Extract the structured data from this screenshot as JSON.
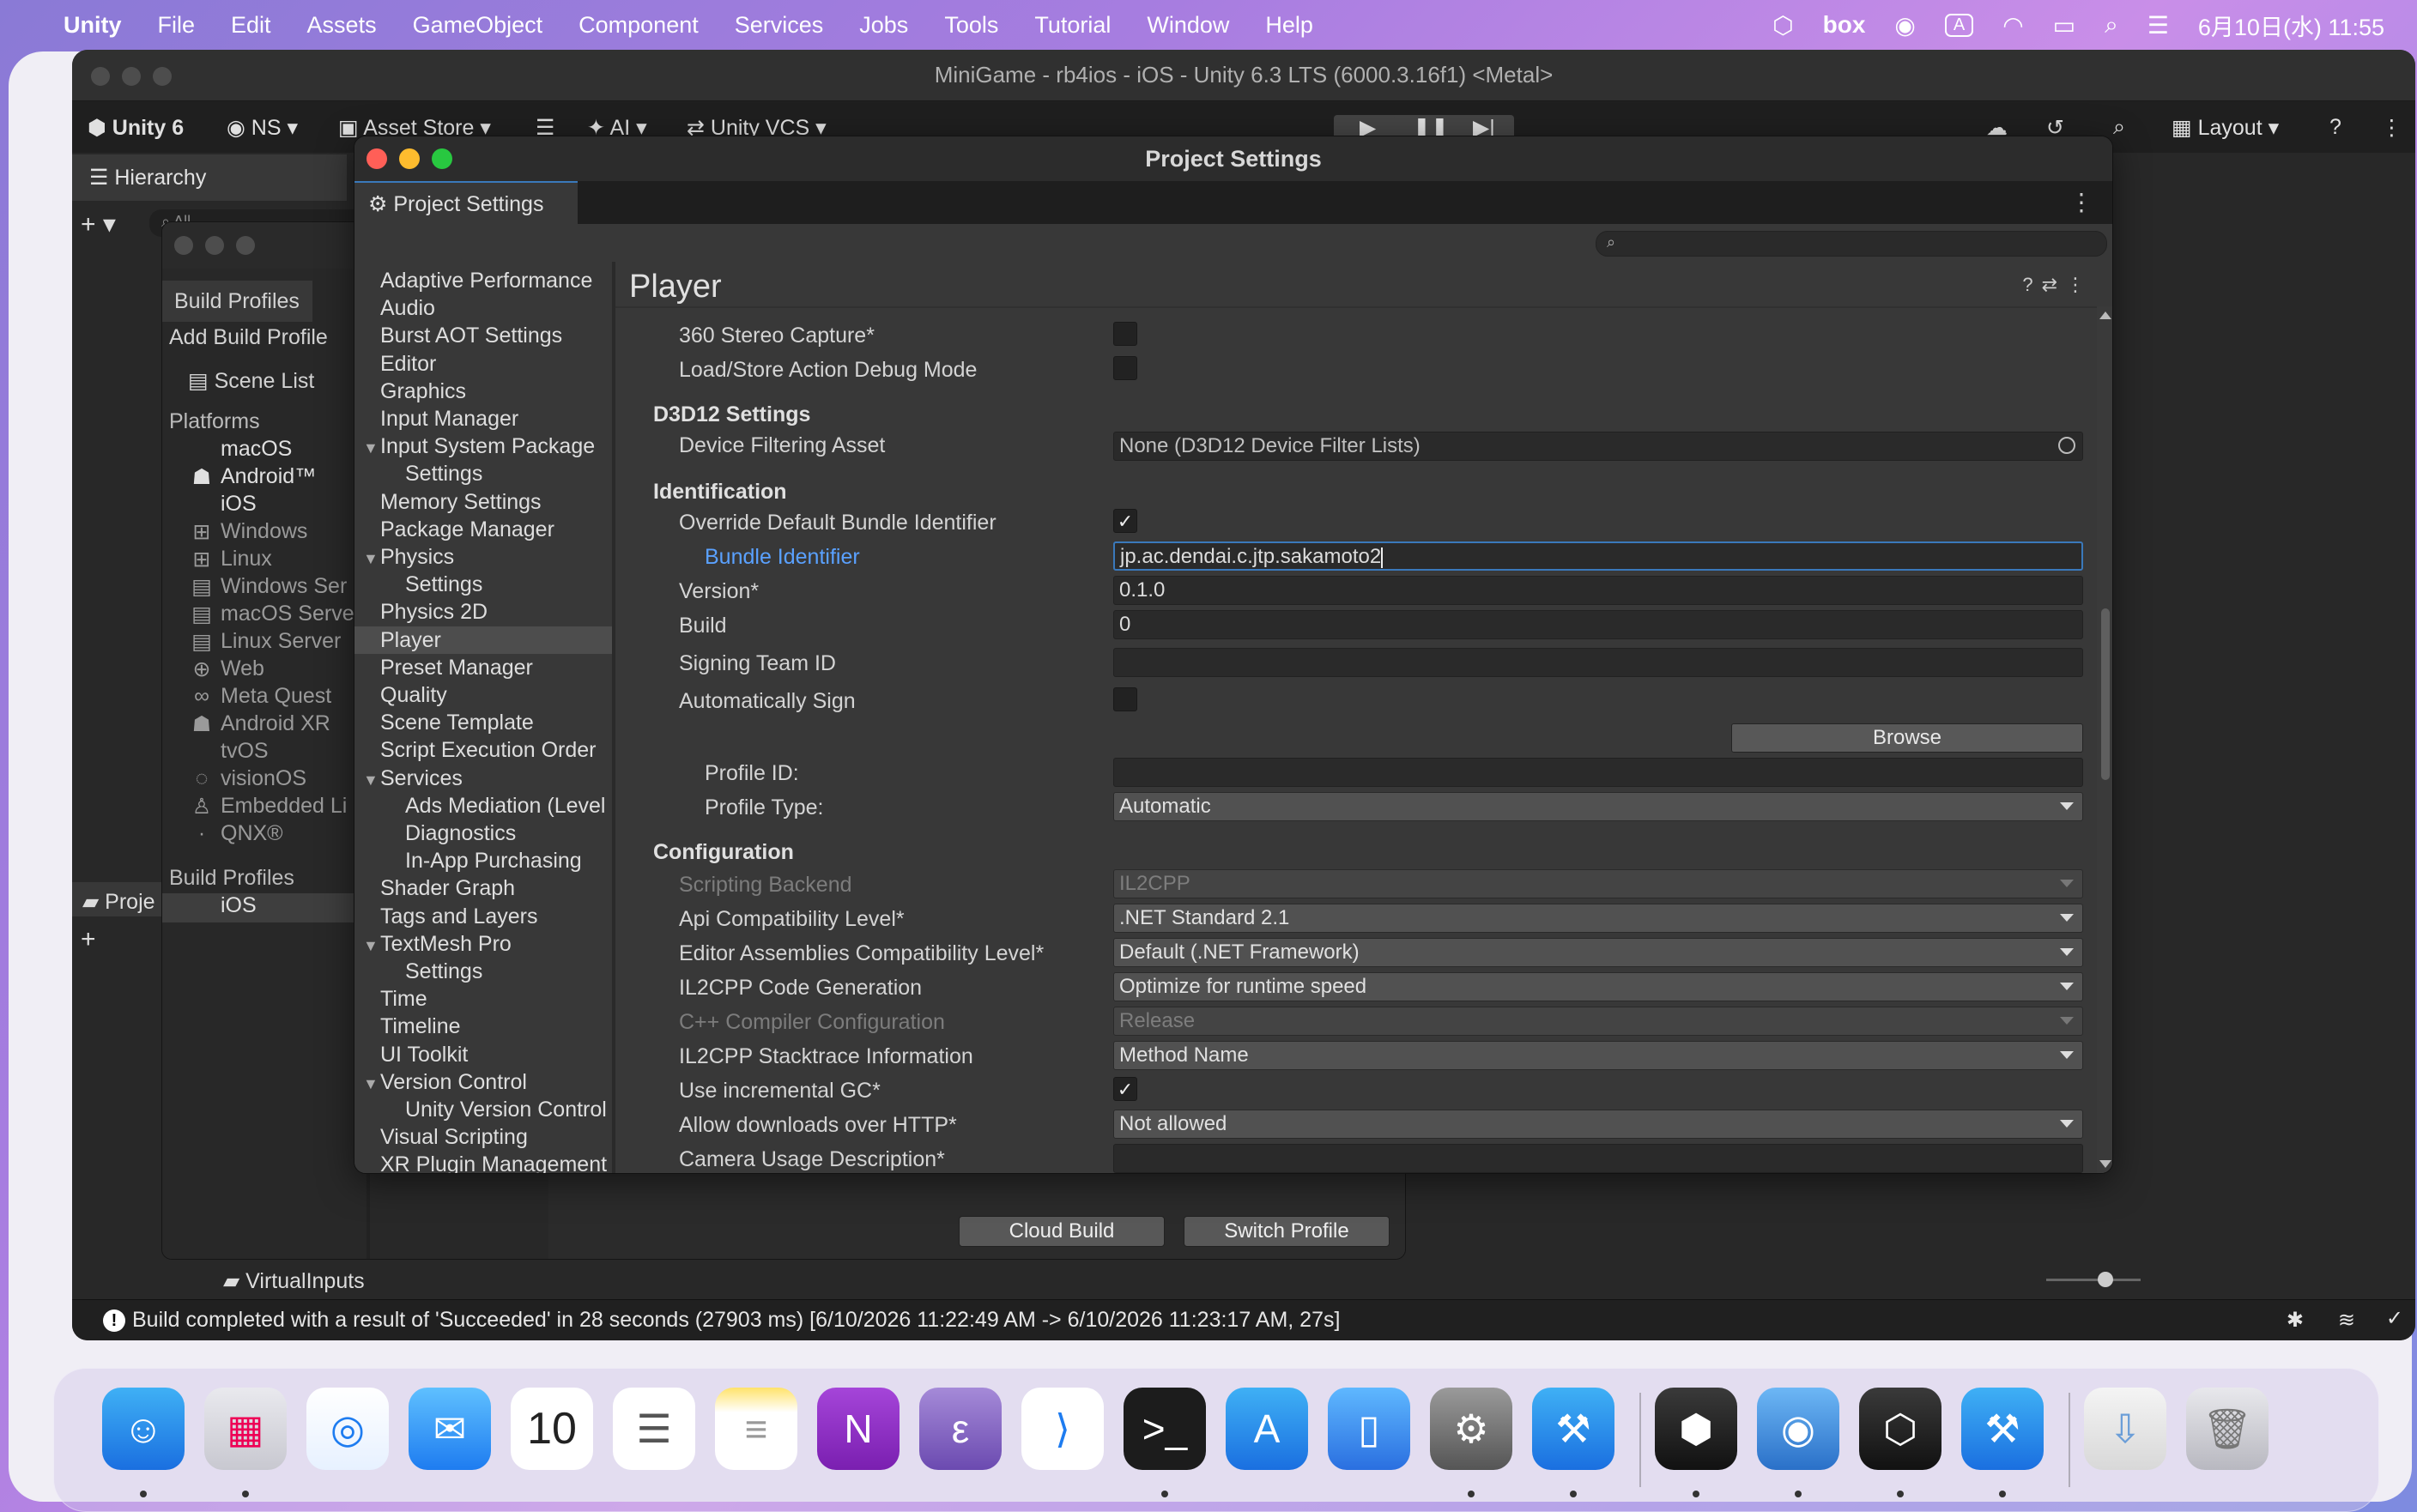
{
  "menubar": {
    "app": "Unity",
    "items": [
      "File",
      "Edit",
      "Assets",
      "GameObject",
      "Component",
      "Services",
      "Jobs",
      "Tools",
      "Tutorial",
      "Window",
      "Help"
    ],
    "box_label": "box",
    "input_badge": "A",
    "clock": "6月10日(水) 11:55"
  },
  "unity": {
    "window_title": "MiniGame - rb4ios - iOS - Unity 6.3 LTS (6000.3.16f1) <Metal>",
    "toolbar": {
      "unity_label": "Unity 6",
      "account": "NS",
      "asset_store": "Asset Store",
      "ai": "AI",
      "vcs": "Unity VCS",
      "layout": "Layout"
    },
    "hierarchy_tab": "Hierarchy",
    "search_placeholder": "All",
    "project_tab": "Proje",
    "virtual_inputs": "VirtualInputs",
    "status_message": "Build completed with a result of 'Succeeded' in 28 seconds (27903 ms) [6/10/2026 11:22:49 AM -> 6/10/2026 11:23:17 AM, 27s]"
  },
  "build_profiles": {
    "tab": "Build Profiles",
    "add": "Add Build Profile",
    "scene_list": "Scene List",
    "platforms_header": "Platforms",
    "platforms": [
      "macOS",
      "Android™",
      "iOS",
      "Windows",
      "Linux",
      "Windows Ser",
      "macOS Serve",
      "Linux Server",
      "Web",
      "Meta Quest",
      "Android XR",
      "tvOS",
      "visionOS",
      "Embedded Li",
      "QNX®"
    ],
    "profiles_header": "Build Profiles",
    "profiles": [
      "iOS"
    ],
    "cloud_build": "Cloud Build",
    "switch_profile": "Switch Profile"
  },
  "project_settings": {
    "window_title": "Project Settings",
    "tab_label": "Project Settings",
    "nav": [
      {
        "label": "Adaptive Performance",
        "level": 0
      },
      {
        "label": "Audio",
        "level": 0
      },
      {
        "label": "Burst AOT Settings",
        "level": 0
      },
      {
        "label": "Editor",
        "level": 0
      },
      {
        "label": "Graphics",
        "level": 0
      },
      {
        "label": "Input Manager",
        "level": 0
      },
      {
        "label": "Input System Package",
        "level": 0,
        "expanded": true
      },
      {
        "label": "Settings",
        "level": 1
      },
      {
        "label": "Memory Settings",
        "level": 0
      },
      {
        "label": "Package Manager",
        "level": 0
      },
      {
        "label": "Physics",
        "level": 0,
        "expanded": true
      },
      {
        "label": "Settings",
        "level": 1
      },
      {
        "label": "Physics 2D",
        "level": 0
      },
      {
        "label": "Player",
        "level": 0,
        "selected": true
      },
      {
        "label": "Preset Manager",
        "level": 0
      },
      {
        "label": "Quality",
        "level": 0
      },
      {
        "label": "Scene Template",
        "level": 0
      },
      {
        "label": "Script Execution Order",
        "level": 0
      },
      {
        "label": "Services",
        "level": 0,
        "expanded": true
      },
      {
        "label": "Ads Mediation (Level",
        "level": 1
      },
      {
        "label": "Diagnostics",
        "level": 1
      },
      {
        "label": "In-App Purchasing",
        "level": 1
      },
      {
        "label": "Shader Graph",
        "level": 0
      },
      {
        "label": "Tags and Layers",
        "level": 0
      },
      {
        "label": "TextMesh Pro",
        "level": 0,
        "expanded": true
      },
      {
        "label": "Settings",
        "level": 1
      },
      {
        "label": "Time",
        "level": 0
      },
      {
        "label": "Timeline",
        "level": 0
      },
      {
        "label": "UI Toolkit",
        "level": 0
      },
      {
        "label": "Version Control",
        "level": 0,
        "expanded": true
      },
      {
        "label": "Unity Version Control",
        "level": 1
      },
      {
        "label": "Visual Scripting",
        "level": 0
      },
      {
        "label": "XR Plugin Management",
        "level": 0
      }
    ],
    "player": {
      "header": "Player",
      "stereo_capture_label": "360 Stereo Capture*",
      "stereo_capture": false,
      "load_store_label": "Load/Store Action Debug Mode",
      "load_store": false,
      "d3d12_header": "D3D12 Settings",
      "device_filter_label": "Device Filtering Asset",
      "device_filter_value": "None (D3D12 Device Filter Lists)",
      "identification_header": "Identification",
      "override_bundle_label": "Override Default Bundle Identifier",
      "override_bundle": true,
      "bundle_id_label": "Bundle Identifier",
      "bundle_id_value": "jp.ac.dendai.c.jtp.sakamoto2",
      "version_label": "Version*",
      "version_value": "0.1.0",
      "build_label": "Build",
      "build_value": "0",
      "signing_team_label": "Signing Team ID",
      "signing_team_value": "",
      "auto_sign_label": "Automatically Sign",
      "auto_sign": false,
      "browse_label": "Browse",
      "profile_id_label": "Profile ID:",
      "profile_id_value": "",
      "profile_type_label": "Profile Type:",
      "profile_type_value": "Automatic",
      "configuration_header": "Configuration",
      "scripting_backend_label": "Scripting Backend",
      "scripting_backend_value": "IL2CPP",
      "api_compat_label": "Api Compatibility Level*",
      "api_compat_value": ".NET Standard 2.1",
      "editor_assemblies_label": "Editor Assemblies Compatibility Level*",
      "editor_assemblies_value": "Default (.NET Framework)",
      "il2cpp_codegen_label": "IL2CPP Code Generation",
      "il2cpp_codegen_value": "Optimize for runtime speed",
      "cpp_compiler_label": "C++ Compiler Configuration",
      "cpp_compiler_value": "Release",
      "stacktrace_label": "IL2CPP Stacktrace Information",
      "stacktrace_value": "Method Name",
      "incremental_gc_label": "Use incremental GC*",
      "incremental_gc": true,
      "http_label": "Allow downloads over HTTP*",
      "http_value": "Not allowed",
      "camera_usage_label": "Camera Usage Description*",
      "camera_usage_value": ""
    }
  },
  "dock": {
    "calendar_day": "10",
    "icons": [
      "finder-icon",
      "launchpad-icon",
      "safari-icon",
      "mail-icon",
      "calendar-icon",
      "reminders-icon",
      "notes-icon",
      "onenote-icon",
      "emacs-icon",
      "vscode-icon",
      "terminal-icon",
      "app-store-icon",
      "simulator-icon",
      "system-settings-icon",
      "xcode-icon",
      "unity-hub-icon",
      "disk-utility-icon",
      "unity-icon",
      "xcode-2-icon",
      "downloads-icon",
      "trash-icon"
    ]
  },
  "colors": {
    "accent": "#3a79bb",
    "link_blue": "#5aa1ff",
    "panel": "#383838",
    "close": "#ff5f57",
    "minimize": "#febc2e",
    "zoom": "#28c840"
  }
}
